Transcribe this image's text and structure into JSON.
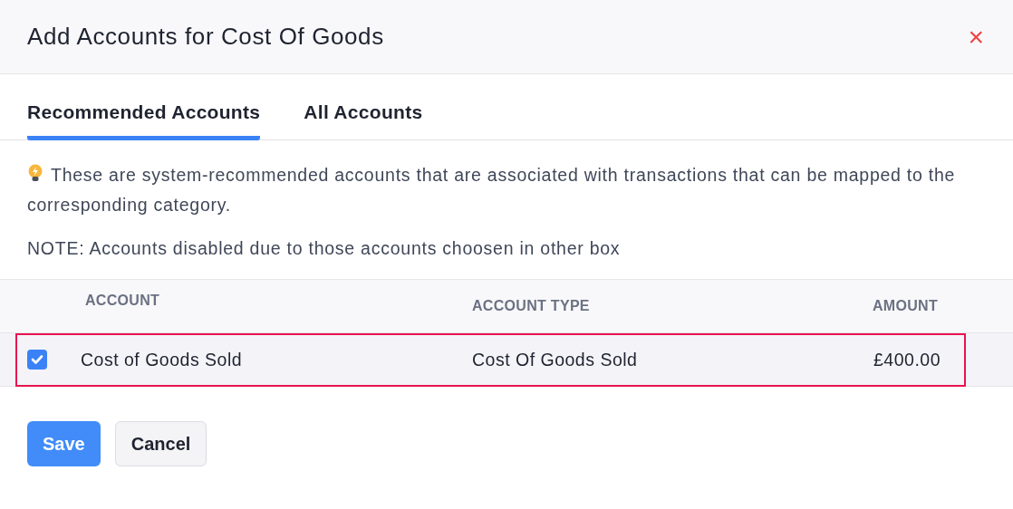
{
  "dialog": {
    "title": "Add Accounts for Cost Of Goods",
    "close": "×"
  },
  "tabs": [
    {
      "label": "Recommended Accounts",
      "selected": true
    },
    {
      "label": "All Accounts",
      "selected": false
    }
  ],
  "info": "These are system-recommended accounts that are associated with transactions that can be mapped to the corresponding category.",
  "note": "NOTE: Accounts disabled due to those accounts choosen in other box",
  "table": {
    "columns": [
      "ACCOUNT",
      "ACCOUNT TYPE",
      "AMOUNT"
    ],
    "rows": [
      {
        "account": "Cost of Goods Sold",
        "account_type": "Cost Of Goods Sold",
        "amount": "£400.00",
        "checked": true,
        "highlighted": true
      }
    ]
  },
  "buttons": [
    {
      "label": "Save",
      "kind": "primary"
    },
    {
      "label": "Cancel",
      "kind": "secondary"
    }
  ]
}
